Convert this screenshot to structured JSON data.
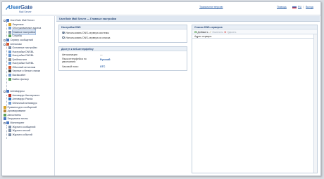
{
  "header": {
    "logo_text_a": "User",
    "logo_text_b": "Gate",
    "logo_sub": "Mail Server",
    "product_link": "Тракыльное версию",
    "help_link": "Помощь",
    "lang_ru": "RU",
    "lang_sep": "|",
    "logout_link": "Выход",
    "flag_colors": [
      "#ffffff",
      "#1d4fb5",
      "#d8232a"
    ]
  },
  "nav": {
    "items": [
      {
        "label": "UserGate Mail Server",
        "icon": "server-icon",
        "color": "#4a78c2"
      },
      {
        "label": "Лицензия",
        "icon": "license-icon",
        "color": "#d9a52b"
      },
      {
        "label": "Обслуживаемые адреса",
        "icon": "address-icon",
        "color": "#6b9ad3"
      },
      {
        "label": "Главные настройки",
        "icon": "settings-icon",
        "color": "#7e8fa8"
      },
      {
        "label": "Службы",
        "icon": "services-icon",
        "color": "#5aa05a"
      },
      {
        "label": "Сервер сообщений",
        "icon": "message-server-icon",
        "color": "#4a78c2"
      },
      {
        "label": "Антиспам",
        "icon": "antispam-icon",
        "color": "#d5572f"
      },
      {
        "label": "Основные настройки",
        "icon": "settings-icon",
        "color": "#7e8fa8"
      },
      {
        "label": "Настройки DNSBL",
        "icon": "dnsbl-icon",
        "color": "#6b9ad3"
      },
      {
        "label": "Настройки DNSBL",
        "icon": "dnsbl-icon",
        "color": "#6b9ad3"
      },
      {
        "label": "Грейлистинг",
        "icon": "greylist-icon",
        "color": "#8f8f8f"
      },
      {
        "label": "Настройки SURBL",
        "icon": "surbl-icon",
        "color": "#6b9ad3"
      },
      {
        "label": "Обычный антиспам",
        "icon": "antispam-icon",
        "color": "#d5572f"
      },
      {
        "label": "Черные и белые списки",
        "icon": "list-icon",
        "color": "#444444"
      },
      {
        "label": "Backscatter",
        "icon": "backscatter-icon",
        "color": "#6b9ad3"
      },
      {
        "label": "Байес фильтр",
        "icon": "bayes-icon",
        "color": "#5aa05a"
      },
      {
        "label": "Антивирусы",
        "icon": "antivirus-icon",
        "color": "#4a78c2"
      },
      {
        "label": "Антивирус Касперского",
        "icon": "kaspersky-icon",
        "color": "#c0392b"
      },
      {
        "label": "Антивирус Panda",
        "icon": "panda-icon",
        "color": "#2a74c0"
      },
      {
        "label": "Облачный антивирус",
        "icon": "cloud-icon",
        "color": "#6b9ad3"
      },
      {
        "label": "Правила для сообщений",
        "icon": "rules-icon",
        "color": "#d9a52b"
      },
      {
        "label": "Архивирование",
        "icon": "archive-icon",
        "color": "#b8863b"
      },
      {
        "label": "Автоответы",
        "icon": "autoreply-icon",
        "color": "#5aa05a"
      },
      {
        "label": "Загрузчики почты",
        "icon": "downloader-icon",
        "color": "#4a78c2"
      },
      {
        "label": "Мониторинг",
        "icon": "monitor-icon",
        "color": "#4a78c2"
      },
      {
        "label": "Журнал сообщений",
        "icon": "log-icon",
        "color": "#7e8fa8"
      },
      {
        "label": "Журнал сессий",
        "icon": "log-icon",
        "color": "#7e8fa8"
      },
      {
        "label": "Журнал событий",
        "icon": "log-icon",
        "color": "#7e8fa8"
      }
    ]
  },
  "main": {
    "title": "UserGate Mail Server — Главные настройки",
    "dns_panel": {
      "title": "Настройки DNS",
      "opt_system": "Использовать DNS-сервера системы",
      "opt_list": "Использовать DNS-сервера из списка",
      "selected": "system"
    },
    "web_panel": {
      "title": "Доступ к веб-интерфейсу",
      "auth_label": "Авторизация:",
      "auth_value": "—",
      "lang_label_1": "Язык интерфейса по",
      "lang_label_2": "умолчанию:",
      "lang_value": "Русский",
      "tz_label": "Часовой пояс:",
      "tz_value": "UTC"
    },
    "dns_list_panel": {
      "title": "Список DNS-серверов",
      "add_label": "Добавить",
      "edit_label": "Изменить",
      "delete_label": "Удалить",
      "column": "Адрес сервера"
    }
  }
}
